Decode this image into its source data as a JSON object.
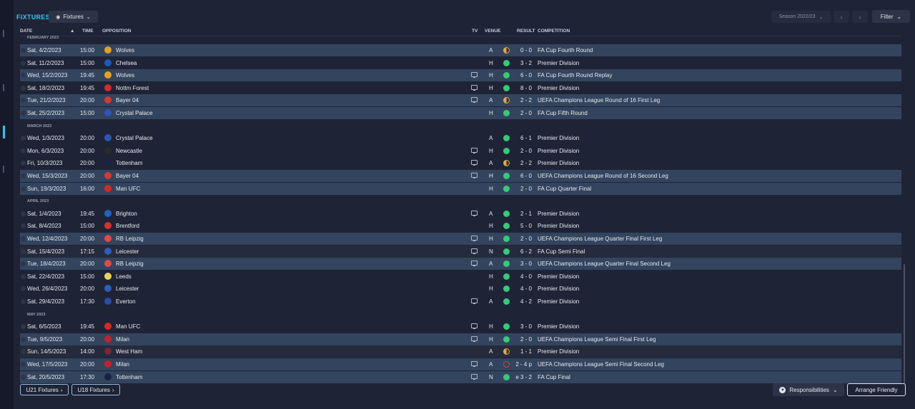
{
  "header": {
    "title": "FIXTURES",
    "fixtures_btn": "Fixtures",
    "season": "Season 2022/23",
    "filter": "Filter"
  },
  "columns": {
    "date": "DATE",
    "time": "TIME",
    "opposition": "OPPOSITION",
    "tv": "TV",
    "venue": "VENUE",
    "result": "RESULT",
    "competition": "COMPETITION"
  },
  "colors": {
    "accent": "#32c8f0",
    "win": "#37c978",
    "draw": "#e6a93c",
    "loss": "#d8453a",
    "highlight_row": "#33445e"
  },
  "groups": [
    {
      "month": "FEBRUARY 2023",
      "rows": [
        {
          "date": "Sat, 4/2/2023",
          "time": "15:00",
          "opp": "Wolves",
          "crest": "#e2a21f",
          "tv": false,
          "venue": "A",
          "outcome": "draw",
          "result": "0 - 0",
          "comp": "FA Cup Fourth Round",
          "style": "hl"
        },
        {
          "date": "Sat, 11/2/2023",
          "time": "15:00",
          "opp": "Chelsea",
          "crest": "#1f58b7",
          "tv": false,
          "venue": "H",
          "outcome": "win",
          "result": "3 - 2",
          "comp": "Premier Division",
          "style": ""
        },
        {
          "date": "Wed, 15/2/2023",
          "time": "19:45",
          "opp": "Wolves",
          "crest": "#e2a21f",
          "tv": true,
          "venue": "H",
          "outcome": "win",
          "result": "6 - 0",
          "comp": "FA Cup Fourth Round Replay",
          "style": "hl"
        },
        {
          "date": "Sat, 18/2/2023",
          "time": "19:45",
          "opp": "Nottm Forest",
          "crest": "#d42a2a",
          "tv": true,
          "venue": "H",
          "outcome": "win",
          "result": "8 - 0",
          "comp": "Premier Division",
          "style": ""
        },
        {
          "date": "Tue, 21/2/2023",
          "time": "20:00",
          "opp": "Bayer 04",
          "crest": "#d43a2f",
          "tv": true,
          "venue": "A",
          "outcome": "draw",
          "result": "2 - 2",
          "comp": "UEFA Champions League Round of 16 First Leg",
          "style": "hl"
        },
        {
          "date": "Sat, 25/2/2023",
          "time": "15:00",
          "opp": "Crystal Palace",
          "crest": "#2a57b8",
          "tv": false,
          "venue": "H",
          "outcome": "win",
          "result": "2 - 0",
          "comp": "FA Cup Fifth Round",
          "style": "hl"
        }
      ]
    },
    {
      "month": "MARCH 2023",
      "rows": [
        {
          "date": "Wed, 1/3/2023",
          "time": "20:00",
          "opp": "Crystal Palace",
          "crest": "#2a57b8",
          "tv": false,
          "venue": "A",
          "outcome": "win",
          "result": "6 - 1",
          "comp": "Premier Division",
          "style": ""
        },
        {
          "date": "Mon, 6/3/2023",
          "time": "20:00",
          "opp": "Newcastle",
          "crest": "#2b2b2b",
          "tv": true,
          "venue": "H",
          "outcome": "win",
          "result": "2 - 0",
          "comp": "Premier Division",
          "style": ""
        },
        {
          "date": "Fri, 10/3/2023",
          "time": "20:00",
          "opp": "Tottenham",
          "crest": "#1a2244",
          "tv": true,
          "venue": "A",
          "outcome": "draw",
          "result": "2 - 2",
          "comp": "Premier Division",
          "style": ""
        },
        {
          "date": "Wed, 15/3/2023",
          "time": "20:00",
          "opp": "Bayer 04",
          "crest": "#d43a2f",
          "tv": true,
          "venue": "H",
          "outcome": "win",
          "result": "6 - 0",
          "comp": "UEFA Champions League Round of 16 Second Leg",
          "style": "hl"
        },
        {
          "date": "Sun, 19/3/2023",
          "time": "16:00",
          "opp": "Man UFC",
          "crest": "#d52b1e",
          "tv": false,
          "venue": "H",
          "outcome": "win",
          "result": "2 - 0",
          "comp": "FA Cup Quarter Final",
          "style": "hl"
        }
      ]
    },
    {
      "month": "APRIL 2023",
      "rows": [
        {
          "date": "Sat, 1/4/2023",
          "time": "19:45",
          "opp": "Brighton",
          "crest": "#1e63c4",
          "tv": true,
          "venue": "A",
          "outcome": "win",
          "result": "2 - 1",
          "comp": "Premier Division",
          "style": ""
        },
        {
          "date": "Sat, 8/4/2023",
          "time": "15:00",
          "opp": "Brentford",
          "crest": "#d9302c",
          "tv": false,
          "venue": "H",
          "outcome": "win",
          "result": "5 - 0",
          "comp": "Premier Division",
          "style": ""
        },
        {
          "date": "Wed, 12/4/2023",
          "time": "20:00",
          "opp": "RB Leipzig",
          "crest": "#e04a4a",
          "tv": true,
          "venue": "H",
          "outcome": "win",
          "result": "2 - 0",
          "comp": "UEFA Champions League Quarter Final First Leg",
          "style": "hl"
        },
        {
          "date": "Sat, 15/4/2023",
          "time": "17:15",
          "opp": "Leicester",
          "crest": "#2c5fb8",
          "tv": true,
          "venue": "N",
          "outcome": "win",
          "result": "6 - 2",
          "comp": "FA Cup Semi Final",
          "style": "dark"
        },
        {
          "date": "Tue, 18/4/2023",
          "time": "20:00",
          "opp": "RB Leipzig",
          "crest": "#e04a4a",
          "tv": true,
          "venue": "A",
          "outcome": "win",
          "result": "3 - 0",
          "comp": "UEFA Champions League Quarter Final Second Leg",
          "style": "hl"
        },
        {
          "date": "Sat, 22/4/2023",
          "time": "15:00",
          "opp": "Leeds",
          "crest": "#e8d45a",
          "tv": false,
          "venue": "H",
          "outcome": "win",
          "result": "4 - 0",
          "comp": "Premier Division",
          "style": ""
        },
        {
          "date": "Wed, 26/4/2023",
          "time": "20:00",
          "opp": "Leicester",
          "crest": "#2c5fb8",
          "tv": false,
          "venue": "H",
          "outcome": "win",
          "result": "4 - 0",
          "comp": "Premier Division",
          "style": ""
        },
        {
          "date": "Sat, 29/4/2023",
          "time": "17:30",
          "opp": "Everton",
          "crest": "#2a4ea8",
          "tv": true,
          "venue": "A",
          "outcome": "win",
          "result": "4 - 2",
          "comp": "Premier Division",
          "style": ""
        }
      ]
    },
    {
      "month": "MAY 2023",
      "rows": [
        {
          "date": "Sat, 6/5/2023",
          "time": "19:45",
          "opp": "Man UFC",
          "crest": "#d52b1e",
          "tv": true,
          "venue": "H",
          "outcome": "win",
          "result": "3 - 0",
          "comp": "Premier Division",
          "style": ""
        },
        {
          "date": "Tue, 9/5/2023",
          "time": "20:00",
          "opp": "Milan",
          "crest": "#c4202b",
          "tv": true,
          "venue": "H",
          "outcome": "win",
          "result": "2 - 0",
          "comp": "UEFA Champions League Semi Final First Leg",
          "style": "hl"
        },
        {
          "date": "Sun, 14/5/2023",
          "time": "14:00",
          "opp": "West Ham",
          "crest": "#7a2638",
          "tv": false,
          "venue": "A",
          "outcome": "draw",
          "result": "1 - 1",
          "comp": "Premier Division",
          "style": "dark"
        },
        {
          "date": "Wed, 17/5/2023",
          "time": "20:00",
          "opp": "Milan",
          "crest": "#c4202b",
          "tv": true,
          "venue": "A",
          "outcome": "loss",
          "result": "2 - 4 p",
          "comp": "UEFA Champions League Semi Final Second Leg",
          "style": "hl"
        },
        {
          "date": "Sat, 20/5/2023",
          "time": "17:30",
          "opp": "Tottenham",
          "crest": "#1a2244",
          "tv": true,
          "venue": "N",
          "outcome": "win",
          "result": "e 3 - 2",
          "comp": "FA Cup Final",
          "style": "hl"
        }
      ]
    }
  ],
  "footer": {
    "u21": "U21 Fixtures",
    "u18": "U18 Fixtures",
    "responsibilities": "Responsibilities",
    "arrange": "Arrange Friendly"
  }
}
